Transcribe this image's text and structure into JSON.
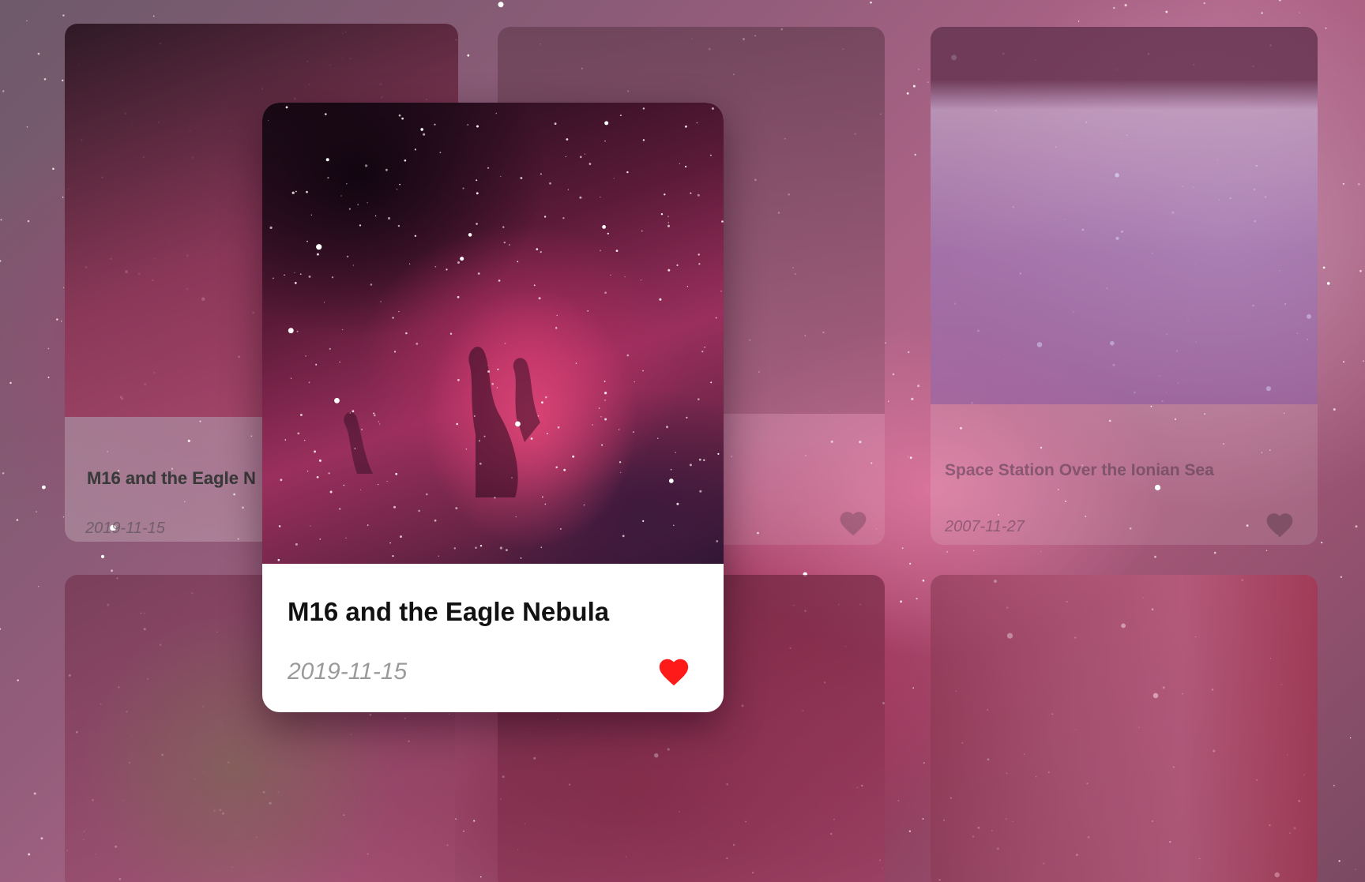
{
  "focused_card": {
    "title": "M16 and the Eagle Nebula",
    "date": "2019-11-15",
    "liked": true,
    "heart_icon": "heart-icon",
    "heart_color": "#ff1a1a"
  },
  "grid_cards": [
    {
      "title": "M16 and the Eagle",
      "title_underlay": "M16 and the Eagle N",
      "date": "2019-11-15"
    },
    {
      "title": "",
      "date": ""
    },
    {
      "title": "Space Station Over the Ionian Sea",
      "date": "2007-11-27"
    },
    {
      "title": "",
      "date": ""
    },
    {
      "title": "",
      "date": ""
    },
    {
      "title": "",
      "date": ""
    }
  ],
  "colors": {
    "card_background": "#ffffff",
    "title_text": "#111111",
    "date_text": "#9a9a9a"
  }
}
